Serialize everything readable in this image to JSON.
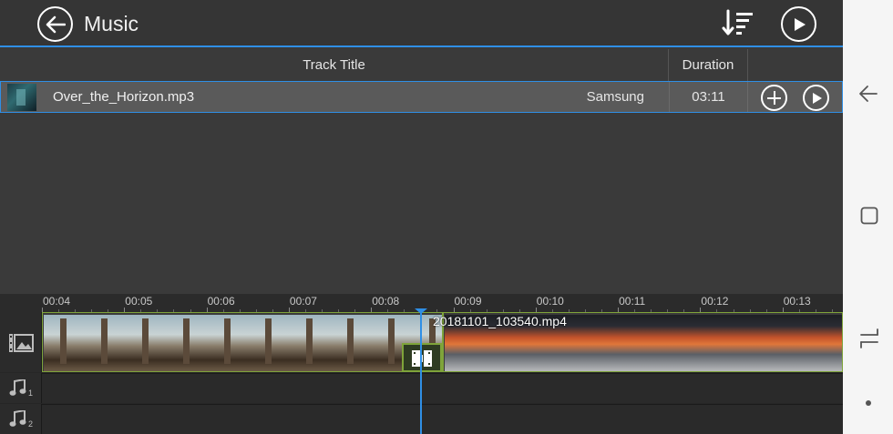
{
  "topbar": {
    "title": "Music"
  },
  "table": {
    "headers": {
      "track_title": "Track Title",
      "duration": "Duration"
    },
    "rows": [
      {
        "title": "Over_the_Horizon.mp3",
        "artist": "Samsung",
        "duration": "03:11"
      }
    ]
  },
  "timeline": {
    "ruler": [
      "00:04",
      "00:05",
      "00:06",
      "00:07",
      "00:08",
      "00:09",
      "00:10",
      "00:11",
      "00:12",
      "00:13"
    ],
    "clip_name": "20181101_103540.mp4",
    "audio_tracks": [
      "1",
      "2"
    ]
  },
  "colors": {
    "accent": "#2f8fe6",
    "clip_border": "#7fa43a",
    "selected_row": "#5a5a5a"
  }
}
